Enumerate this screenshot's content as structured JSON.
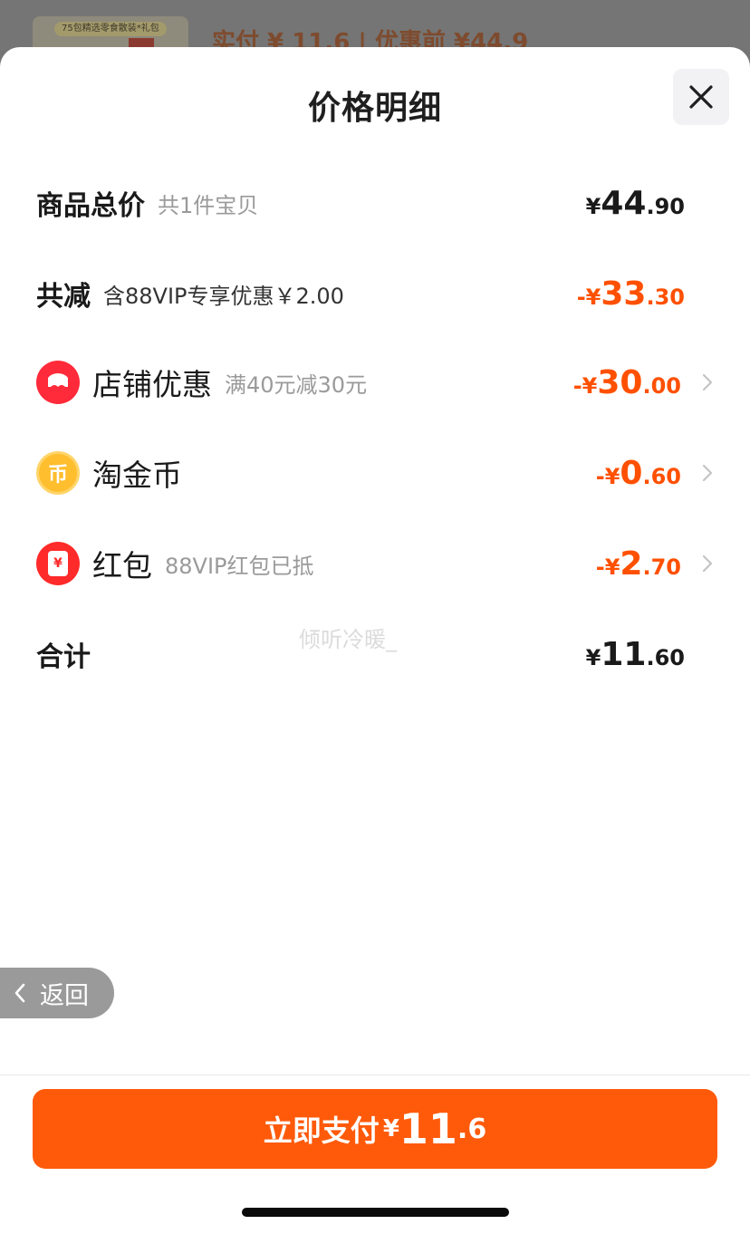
{
  "background_page": {
    "thumb_tag": "75包精选零食散装*礼包",
    "price_text": "实付 ¥ 11.6 | 优惠前 ¥44.9"
  },
  "sheet": {
    "title": "价格明细",
    "close_icon": "close-icon"
  },
  "rows": [
    {
      "id": "subtotal",
      "label": "商品总价",
      "sub": "共1件宝贝",
      "sign": "¥",
      "int": "44",
      "dec": ".90",
      "color": "#1a1a1a"
    },
    {
      "id": "total-discount",
      "label": "共减",
      "sub": "含88VIP专享优惠￥2.00",
      "sign": "-¥",
      "int": "33",
      "dec": ".30",
      "color": "#ff5000"
    },
    {
      "id": "store-discount",
      "icon": "store-coupon-icon",
      "label": "店铺优惠",
      "sub": "满40元减30元",
      "sign": "-¥",
      "int": "30",
      "dec": ".00",
      "color": "#ff5000"
    },
    {
      "id": "taojinbi",
      "icon": "taojinbi-coin-icon",
      "icon_char": "币",
      "label": "淘金币",
      "sub": "",
      "sign": "-¥",
      "int": "0",
      "dec": ".60",
      "color": "#ff5000"
    },
    {
      "id": "hongbao",
      "icon": "red-envelope-icon",
      "icon_char": "¥",
      "label": "红包",
      "sub": "88VIP红包已抵",
      "sign": "-¥",
      "int": "2",
      "dec": ".70",
      "color": "#ff5000"
    },
    {
      "id": "total",
      "label": "合计",
      "sub": "",
      "sign": "¥",
      "int": "11",
      "dec": ".60",
      "color": "#1a1a1a"
    }
  ],
  "watermark": "倾听冷暖_",
  "back_button": {
    "label": "返回",
    "icon": "chevron-left-icon"
  },
  "pay_button": {
    "label": "立即支付",
    "sign": "¥",
    "int": "11",
    "dec": ".6"
  },
  "colors": {
    "accent": "#ff5000",
    "pay_button": "#ff5a0a"
  }
}
